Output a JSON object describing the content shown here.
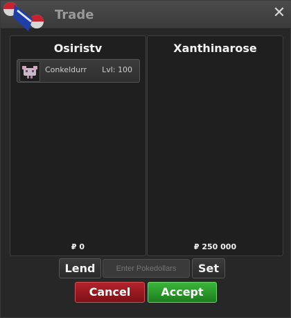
{
  "window": {
    "title": "Trade"
  },
  "left": {
    "player": "Osiristv",
    "items": [
      {
        "name": "Conkeldurr",
        "level": "Lvl: 100"
      }
    ],
    "money": "₽ 0"
  },
  "right": {
    "player": "Xanthinarose",
    "money": "₽ 250 000"
  },
  "controls": {
    "lend_label": "Lend",
    "pokedollars_placeholder": "Enter Pokedollars",
    "set_label": "Set",
    "cancel_label": "Cancel",
    "accept_label": "Accept"
  },
  "colors": {
    "cancel": "#9d1a22",
    "accept": "#2a9a2a",
    "panel_bg": "#1f1f1f"
  }
}
